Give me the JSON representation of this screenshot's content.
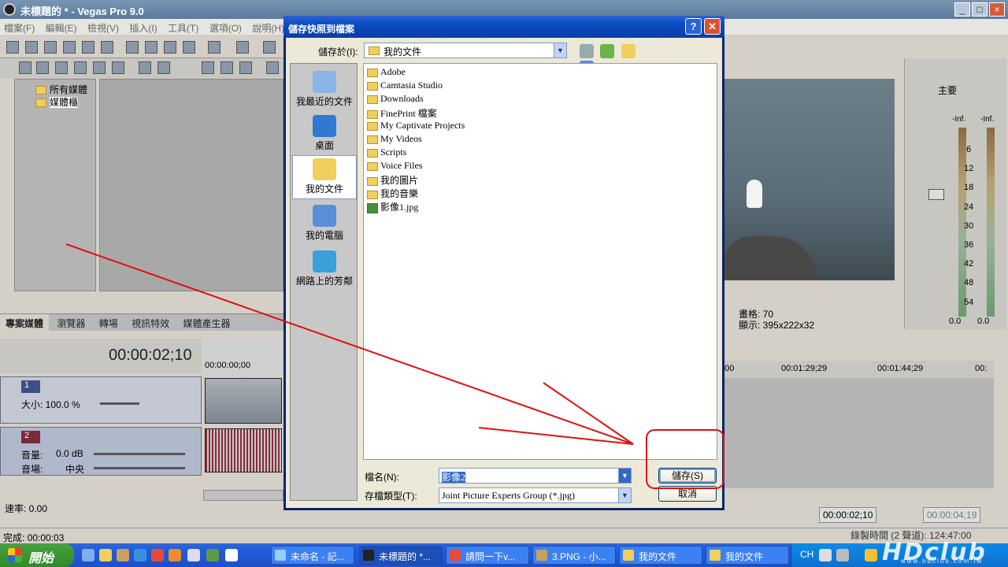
{
  "app": {
    "title": "未標題的 * - Vegas Pro 9.0",
    "menu": [
      "檔案(F)",
      "編輯(E)",
      "檢視(V)",
      "插入(I)",
      "工具(T)",
      "選項(O)",
      "說明(H)"
    ],
    "explorer_items": [
      "所有媒體",
      "媒體櫃"
    ],
    "tabs": [
      "專案媒體",
      "瀏覽器",
      "轉場",
      "視訊特效",
      "媒體產生器"
    ],
    "timecode": "00:00:02;10",
    "ruler_start": "00:00:00;00",
    "track1": {
      "number": "1",
      "size_label": "大小: 100.0 %"
    },
    "track2": {
      "number": "2",
      "volume_label": "音量:",
      "volume_value": "0.0 dB",
      "pan_label": "音場:",
      "pan_value": "中央"
    },
    "rate": "速率: 0.00",
    "status_done": "完成: 00:00:03",
    "preview": {
      "frame_label": "畫格: 70",
      "display_label": "顯示: 395x222x32"
    },
    "mixer": {
      "title": "主要",
      "left_peak": "-Inf.",
      "right_peak": "-Inf.",
      "scale": [
        "6",
        "12",
        "18",
        "24",
        "30",
        "36",
        "42",
        "48",
        "54"
      ],
      "left_value": "0.0",
      "right_value": "0.0"
    },
    "ruler_right": [
      "00",
      "00:01:29;29",
      "00:01:44;29",
      "00:"
    ],
    "time_current": "00:00:02;10",
    "time_end": "00:00:04;19",
    "record_time": "錄製時間 (2 聲道): 124:47:00"
  },
  "dialog": {
    "title": "儲存快照到檔案",
    "help": "?",
    "close": "✕",
    "save_in_label": "儲存於(I):",
    "save_in_value": "我的文件",
    "places": [
      "我最近的文件",
      "桌面",
      "我的文件",
      "我的電腦",
      "網路上的芳鄰"
    ],
    "files": [
      {
        "name": "Adobe",
        "type": "folder"
      },
      {
        "name": "Camtasia Studio",
        "type": "folder"
      },
      {
        "name": "Downloads",
        "type": "folder"
      },
      {
        "name": "FinePrint 檔案",
        "type": "folder"
      },
      {
        "name": "My Captivate Projects",
        "type": "folder"
      },
      {
        "name": "My Videos",
        "type": "folder"
      },
      {
        "name": "Scripts",
        "type": "folder"
      },
      {
        "name": "Voice Files",
        "type": "folder"
      },
      {
        "name": "我的圖片",
        "type": "folder"
      },
      {
        "name": "我的音樂",
        "type": "folder"
      },
      {
        "name": "影像1.jpg",
        "type": "jpg"
      }
    ],
    "filename_label": "檔名(N):",
    "filename_value": "影像2",
    "filetype_label": "存檔類型(T):",
    "filetype_value": "Joint Picture Experts Group (*.jpg)",
    "save_button": "儲存(S)",
    "cancel_button": "取消"
  },
  "taskbar": {
    "start": "開始",
    "tasks": [
      "未命名 - 記...",
      "未標題的 *...",
      "請問一下v...",
      "3.PNG - 小...",
      "我的文件",
      "我的文件"
    ],
    "lang": "CH"
  },
  "watermark": {
    "text": "HDclub",
    "sub": "www.hdclub.com.tw"
  },
  "colors": {
    "annotation": "#e01010",
    "xp_blue": "#0a4ac0"
  }
}
